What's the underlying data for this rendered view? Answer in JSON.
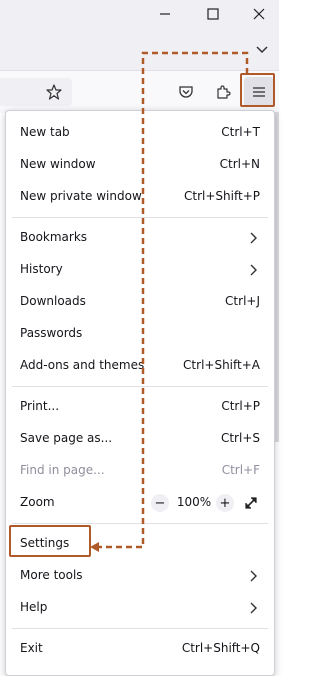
{
  "window": {
    "minimize_icon": "minimize-icon",
    "maximize_icon": "maximize-icon",
    "close_icon": "close-icon",
    "list_tabs_icon": "chevron-down-icon"
  },
  "toolbar": {
    "bookmark_star_icon": "star-icon",
    "pocket_icon": "pocket-icon",
    "extensions_icon": "puzzle-icon",
    "menu_icon": "hamburger-icon"
  },
  "menu": {
    "new_tab": {
      "label": "New tab",
      "shortcut": "Ctrl+T"
    },
    "new_window": {
      "label": "New window",
      "shortcut": "Ctrl+N"
    },
    "new_private_window": {
      "label": "New private window",
      "shortcut": "Ctrl+Shift+P"
    },
    "bookmarks": {
      "label": "Bookmarks"
    },
    "history": {
      "label": "History"
    },
    "downloads": {
      "label": "Downloads",
      "shortcut": "Ctrl+J"
    },
    "passwords": {
      "label": "Passwords"
    },
    "addons": {
      "label": "Add-ons and themes",
      "shortcut": "Ctrl+Shift+A"
    },
    "print": {
      "label": "Print...",
      "shortcut": "Ctrl+P"
    },
    "save_page": {
      "label": "Save page as...",
      "shortcut": "Ctrl+S"
    },
    "find_in_page": {
      "label": "Find in page...",
      "shortcut": "Ctrl+F"
    },
    "zoom": {
      "label": "Zoom",
      "minus": "−",
      "value": "100%",
      "plus": "+"
    },
    "settings": {
      "label": "Settings"
    },
    "more_tools": {
      "label": "More tools"
    },
    "help": {
      "label": "Help"
    },
    "exit": {
      "label": "Exit",
      "shortcut": "Ctrl+Shift+Q"
    }
  },
  "colors": {
    "annotation": "#b05a2a",
    "menu_border": "#cfcfd8",
    "disabled_text": "#8f8f9d"
  }
}
